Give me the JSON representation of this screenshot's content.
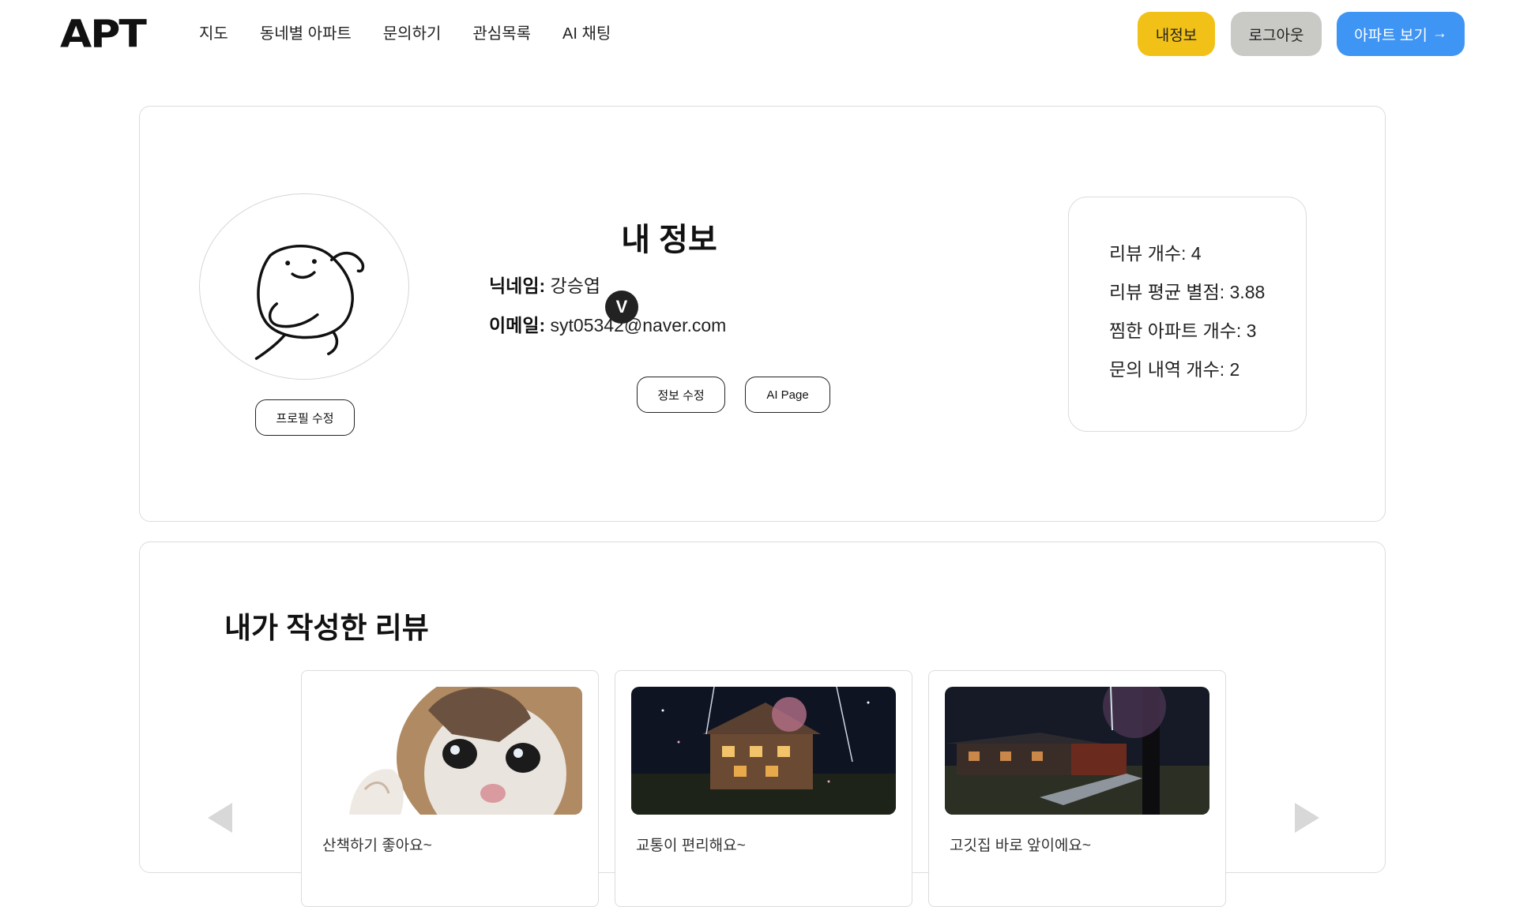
{
  "nav": {
    "logo": "APT",
    "links": [
      "지도",
      "동네별 아파트",
      "문의하기",
      "관심목록",
      "AI 채팅"
    ],
    "my_info": "내정보",
    "logout": "로그아웃",
    "view_apt": "아파트 보기",
    "view_apt_arrow": "→",
    "colors": {
      "my_info": "#f2c117",
      "logout": "#c9c9c6",
      "view_apt": "#3f95f4"
    }
  },
  "profile": {
    "title": "내 정보",
    "nickname_label": "닉네임:",
    "nickname": "강승엽",
    "email_label": "이메일:",
    "email": "syt05342@naver.com",
    "edit_profile_button": "프로필 수정",
    "edit_info_button": "정보 수정",
    "ai_page_button": "AI Page"
  },
  "stats": {
    "review_count": "리뷰 개수: 4",
    "avg_rating": "리뷰 평균 별점: 3.88",
    "liked_apts": "찜한 아파트 개수: 3",
    "inquiries": "문의 내역 개수: 2"
  },
  "reviews": {
    "title": "내가 작성한 리뷰",
    "items": [
      {
        "text": "산책하기 좋아요~",
        "image": "crying-cat"
      },
      {
        "text": "교통이 편리해요~",
        "image": "night-house"
      },
      {
        "text": "고깃집 바로 앞이에요~",
        "image": "night-hanok"
      }
    ],
    "badge": "V"
  }
}
